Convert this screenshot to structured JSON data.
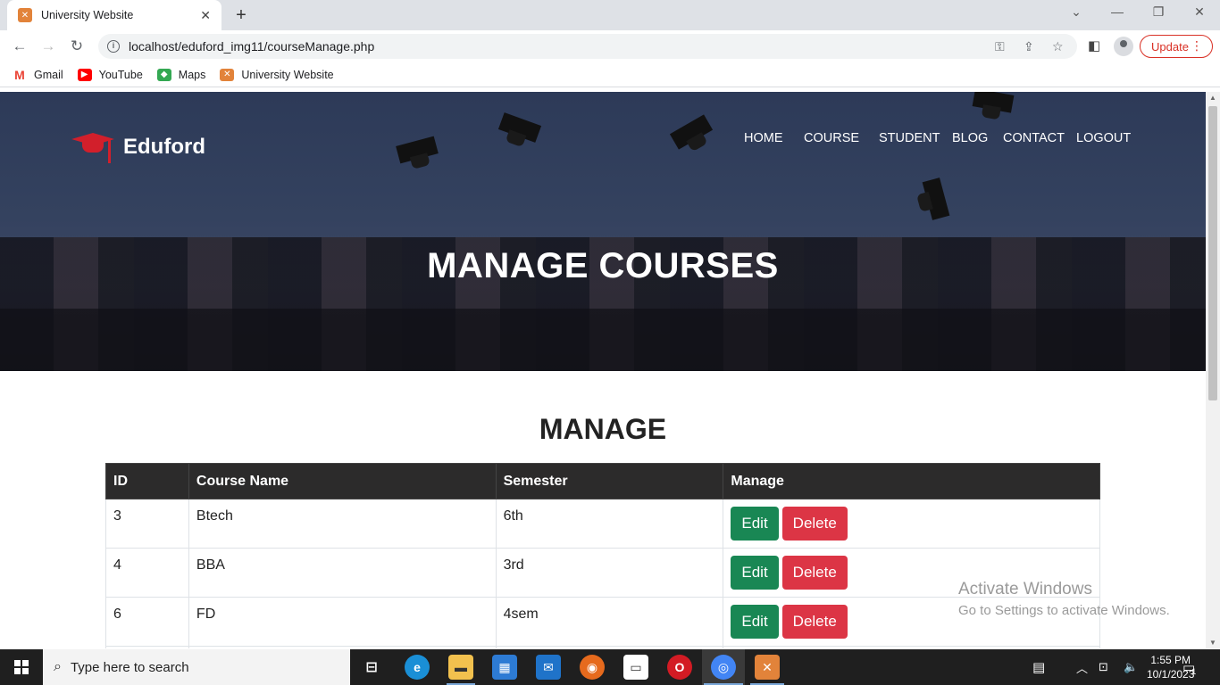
{
  "browser": {
    "tab_title": "University Website",
    "url": "localhost/eduford_img11/courseManage.php",
    "update_label": "Update",
    "bookmarks": [
      {
        "label": "Gmail",
        "icon": "gmail-icon",
        "color": "#ea4335"
      },
      {
        "label": "YouTube",
        "icon": "youtube-icon",
        "color": "#ff0000"
      },
      {
        "label": "Maps",
        "icon": "maps-icon",
        "color": "#34a853"
      },
      {
        "label": "University Website",
        "icon": "xampp-icon",
        "color": "#e2833a"
      }
    ]
  },
  "site": {
    "brand": "Eduford",
    "nav": [
      "HOME",
      "COURSE",
      "STUDENT",
      "BLOG",
      "CONTACT",
      "LOGOUT"
    ],
    "hero_title": "MANAGE COURSES",
    "section_title": "MANAGE",
    "accent": "#d21f2b"
  },
  "table": {
    "headers": [
      "ID",
      "Course Name",
      "Semester",
      "Manage"
    ],
    "rows": [
      {
        "id": "3",
        "course": "Btech",
        "semester": "6th"
      },
      {
        "id": "4",
        "course": "BBA",
        "semester": "3rd"
      },
      {
        "id": "6",
        "course": "FD",
        "semester": "4sem"
      }
    ],
    "edit_label": "Edit",
    "delete_label": "Delete",
    "edit_color": "#198754",
    "delete_color": "#dc3545"
  },
  "watermark": {
    "title": "Activate Windows",
    "subtitle": "Go to Settings to activate Windows."
  },
  "taskbar": {
    "search_placeholder": "Type here to search",
    "time": "1:55 PM",
    "date": "10/1/2023",
    "notification_count": "1"
  }
}
